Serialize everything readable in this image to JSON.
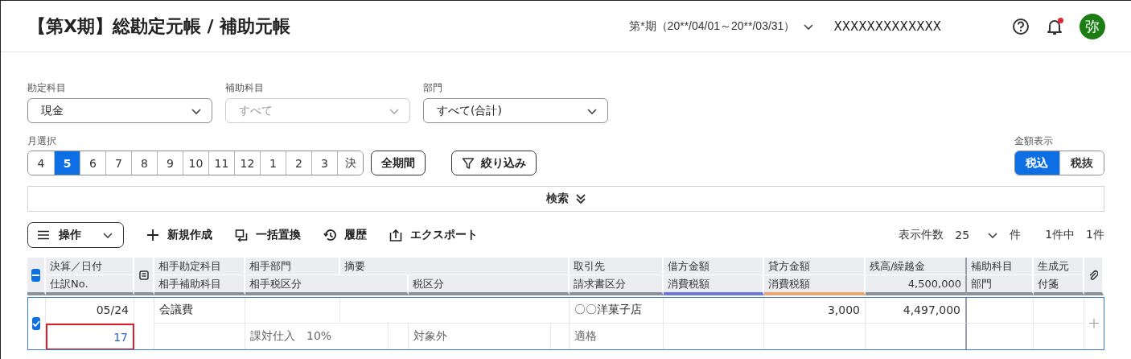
{
  "header": {
    "title": "【第X期】総勘定元帳 / 補助元帳",
    "period": "第*期（20**/04/01～20**/03/31）",
    "company": "XXXXXXXXXXXXX",
    "notification": true,
    "avatar": "弥"
  },
  "filters": {
    "fields": [
      {
        "label": "勘定科目",
        "value": "現金",
        "disabled": false
      },
      {
        "label": "補助科目",
        "value": "すべて",
        "disabled": true
      },
      {
        "label": "部門",
        "value": "すべて(合計)",
        "disabled": false
      }
    ],
    "month_label": "月選択",
    "months": [
      {
        "label": "4",
        "selected": false
      },
      {
        "label": "5",
        "selected": true
      },
      {
        "label": "6",
        "selected": false
      },
      {
        "label": "7",
        "selected": false
      },
      {
        "label": "8",
        "selected": false
      },
      {
        "label": "9",
        "selected": false
      },
      {
        "label": "10",
        "selected": false
      },
      {
        "label": "11",
        "selected": false
      },
      {
        "label": "12",
        "selected": false
      },
      {
        "label": "1",
        "selected": false
      },
      {
        "label": "2",
        "selected": false
      },
      {
        "label": "3",
        "selected": false
      },
      {
        "label": "決",
        "selected": false
      }
    ],
    "all_period": "全期間",
    "filter_button": "絞り込み",
    "amount_label": "金額表示",
    "amount_modes": [
      {
        "label": "税込",
        "selected": true
      },
      {
        "label": "税抜",
        "selected": false
      }
    ]
  },
  "search": {
    "label": "検索",
    "expanded": false
  },
  "toolbar": {
    "actions": [
      {
        "label": "操作",
        "kind": "menu"
      },
      {
        "label": "新規作成",
        "kind": "new"
      },
      {
        "label": "一括置換",
        "kind": "replace"
      },
      {
        "label": "履歴",
        "kind": "history"
      },
      {
        "label": "エクスポート",
        "kind": "export"
      }
    ],
    "page_size_label": "表示件数",
    "page_size": "25",
    "page_size_unit": "件",
    "total_of": "1件中",
    "total": "1件"
  },
  "table": {
    "select_all_checked": true,
    "select_all_partial": true,
    "header_row_1": [
      "決算／日付",
      "相手勘定科目",
      "相手部門",
      "摘要",
      "取引先",
      "借方金額",
      "貸方金額",
      "残高/繰越金",
      "補助科目",
      "生成元"
    ],
    "header_row_2": [
      "仕訳No.",
      "相手補助科目",
      "相手税区分",
      "税区分",
      "請求書区分",
      "消費税額",
      "消費税額",
      "4,500,000",
      "部門",
      "付箋"
    ],
    "rows": [
      {
        "selected": true,
        "date": "05/24",
        "journal_no": "17",
        "journal_no_highlighted": true,
        "counter_account": "会議費",
        "partner": "〇〇洋菓子店",
        "credit": "3,000",
        "balance": "4,497,000",
        "counter_tax_category": "課対仕入　10%",
        "tax_category": "対象外",
        "invoice_type": "適格"
      }
    ]
  }
}
